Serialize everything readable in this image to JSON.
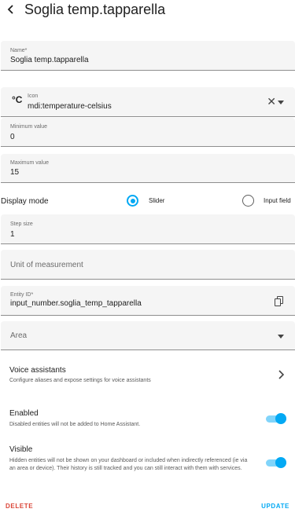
{
  "header": {
    "title": "Soglia temp.tapparella"
  },
  "name_field": {
    "label": "Name*",
    "value": "Soglia temp.tapparella"
  },
  "icon_field": {
    "label": "Icon",
    "value": "mdi:temperature-celsius",
    "glyph": "°C"
  },
  "min_field": {
    "label": "Minimum value",
    "value": "0"
  },
  "max_field": {
    "label": "Maximum value",
    "value": "15"
  },
  "display_mode": {
    "label": "Display mode",
    "option_slider": "Slider",
    "option_input": "Input field",
    "selected": "Slider"
  },
  "step_field": {
    "label": "Step size",
    "value": "1"
  },
  "unit_field": {
    "placeholder": "Unit of measurement"
  },
  "entity_field": {
    "label": "Entity ID*",
    "value": "input_number.soglia_temp_tapparella"
  },
  "area_field": {
    "placeholder": "Area"
  },
  "voice": {
    "title": "Voice assistants",
    "description": "Configure aliases and expose settings for voice assistants"
  },
  "enabled": {
    "title": "Enabled",
    "description": "Disabled entities will not be added to Home Assistant.",
    "on": true
  },
  "visible": {
    "title": "Visible",
    "description": "Hidden entities will not be shown on your dashboard or included when indirectly referenced (ie via an area or device). Their history is still tracked and you can still interact with them with services.",
    "on": true
  },
  "actions": {
    "delete_label": "DELETE",
    "update_label": "UPDATE"
  },
  "colors": {
    "accent": "#03a9f4",
    "danger": "#db4437",
    "field_bg": "#f5f5f5"
  }
}
